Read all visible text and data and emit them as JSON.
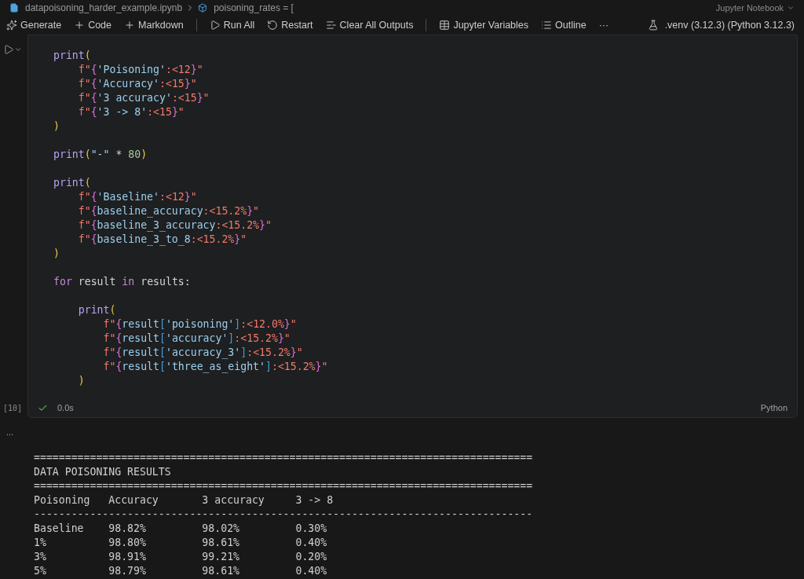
{
  "breadcrumb": {
    "file": "datapoisoning_harder_example.ipynb",
    "symbol": "poisoning_rates = ["
  },
  "editor_mode": "Jupyter Notebook",
  "toolbar": [
    {
      "kind": "generate",
      "label": "Generate"
    },
    {
      "kind": "add",
      "label": "Code"
    },
    {
      "kind": "add",
      "label": "Markdown"
    },
    {
      "kind": "separator"
    },
    {
      "kind": "run",
      "label": "Run All"
    },
    {
      "kind": "restart",
      "label": "Restart"
    },
    {
      "kind": "clear",
      "label": "Clear All Outputs"
    },
    {
      "kind": "separator"
    },
    {
      "kind": "variables",
      "label": "Jupyter Variables"
    },
    {
      "kind": "outline",
      "label": "Outline"
    },
    {
      "kind": "more",
      "label": "···"
    }
  ],
  "kernel": ".venv (3.12.3) (Python 3.12.3)",
  "cell": {
    "execution_count": "[10]",
    "succeeded": true,
    "duration": "0.0s",
    "language": "Python",
    "lines": [
      {
        "kind": "code",
        "tokens": [
          {
            "kind": "fn",
            "text": "print"
          },
          {
            "kind": "paren",
            "text": "("
          }
        ]
      },
      {
        "kind": "code",
        "tokens": [
          {
            "kind": "fstr",
            "text": "    f\""
          },
          {
            "kind": "brace",
            "text": "{"
          },
          {
            "kind": "expr",
            "text": "'Poisoning'"
          },
          {
            "kind": "spec",
            "text": ":<12"
          },
          {
            "kind": "brace",
            "text": "}"
          },
          {
            "kind": "fstr",
            "text": "\""
          }
        ]
      },
      {
        "kind": "code",
        "tokens": [
          {
            "kind": "fstr",
            "text": "    f\""
          },
          {
            "kind": "brace",
            "text": "{"
          },
          {
            "kind": "expr",
            "text": "'Accuracy'"
          },
          {
            "kind": "spec",
            "text": ":<15"
          },
          {
            "kind": "brace",
            "text": "}"
          },
          {
            "kind": "fstr",
            "text": "\""
          }
        ]
      },
      {
        "kind": "code",
        "tokens": [
          {
            "kind": "fstr",
            "text": "    f\""
          },
          {
            "kind": "brace",
            "text": "{"
          },
          {
            "kind": "expr",
            "text": "'3 accuracy'"
          },
          {
            "kind": "spec",
            "text": ":<15"
          },
          {
            "kind": "brace",
            "text": "}"
          },
          {
            "kind": "fstr",
            "text": "\""
          }
        ]
      },
      {
        "kind": "code",
        "tokens": [
          {
            "kind": "fstr",
            "text": "    f\""
          },
          {
            "kind": "brace",
            "text": "{"
          },
          {
            "kind": "expr",
            "text": "'3 -> 8'"
          },
          {
            "kind": "spec",
            "text": ":<15"
          },
          {
            "kind": "brace",
            "text": "}"
          },
          {
            "kind": "fstr",
            "text": "\""
          }
        ]
      },
      {
        "kind": "code",
        "tokens": [
          {
            "kind": "paren",
            "text": ")"
          }
        ]
      },
      {
        "kind": "blank"
      },
      {
        "kind": "code",
        "tokens": [
          {
            "kind": "fn",
            "text": "print"
          },
          {
            "kind": "paren",
            "text": "("
          },
          {
            "kind": "str",
            "text": "\"-\""
          },
          {
            "kind": "op",
            "text": " * "
          },
          {
            "kind": "num",
            "text": "80"
          },
          {
            "kind": "paren",
            "text": ")"
          }
        ]
      },
      {
        "kind": "blank"
      },
      {
        "kind": "code",
        "tokens": [
          {
            "kind": "fn",
            "text": "print"
          },
          {
            "kind": "paren",
            "text": "("
          }
        ]
      },
      {
        "kind": "code",
        "tokens": [
          {
            "kind": "fstr",
            "text": "    f\""
          },
          {
            "kind": "brace",
            "text": "{"
          },
          {
            "kind": "expr",
            "text": "'Baseline'"
          },
          {
            "kind": "spec",
            "text": ":<12"
          },
          {
            "kind": "brace",
            "text": "}"
          },
          {
            "kind": "fstr",
            "text": "\""
          }
        ]
      },
      {
        "kind": "code",
        "tokens": [
          {
            "kind": "fstr",
            "text": "    f\""
          },
          {
            "kind": "brace",
            "text": "{"
          },
          {
            "kind": "expr",
            "text": "baseline_accuracy"
          },
          {
            "kind": "spec",
            "text": ":<15.2%"
          },
          {
            "kind": "brace",
            "text": "}"
          },
          {
            "kind": "fstr",
            "text": "\""
          }
        ]
      },
      {
        "kind": "code",
        "tokens": [
          {
            "kind": "fstr",
            "text": "    f\""
          },
          {
            "kind": "brace",
            "text": "{"
          },
          {
            "kind": "expr",
            "text": "baseline_3_accuracy"
          },
          {
            "kind": "spec",
            "text": ":<15.2%"
          },
          {
            "kind": "brace",
            "text": "}"
          },
          {
            "kind": "fstr",
            "text": "\""
          }
        ]
      },
      {
        "kind": "code",
        "tokens": [
          {
            "kind": "fstr",
            "text": "    f\""
          },
          {
            "kind": "brace",
            "text": "{"
          },
          {
            "kind": "expr",
            "text": "baseline_3_to_8"
          },
          {
            "kind": "spec",
            "text": ":<15.2%"
          },
          {
            "kind": "brace",
            "text": "}"
          },
          {
            "kind": "fstr",
            "text": "\""
          }
        ]
      },
      {
        "kind": "code",
        "tokens": [
          {
            "kind": "paren",
            "text": ")"
          }
        ]
      },
      {
        "kind": "blank"
      },
      {
        "kind": "code",
        "tokens": [
          {
            "kind": "kw",
            "text": "for"
          },
          {
            "kind": "op",
            "text": " result "
          },
          {
            "kind": "kw",
            "text": "in"
          },
          {
            "kind": "op",
            "text": " results:"
          }
        ]
      },
      {
        "kind": "blank"
      },
      {
        "kind": "code",
        "tokens": [
          {
            "kind": "fn",
            "text": "    print"
          },
          {
            "kind": "paren",
            "text": "("
          }
        ]
      },
      {
        "kind": "code",
        "tokens": [
          {
            "kind": "fstr",
            "text": "        f\""
          },
          {
            "kind": "brace",
            "text": "{"
          },
          {
            "kind": "expr",
            "text": "result"
          },
          {
            "kind": "bracket",
            "text": "["
          },
          {
            "kind": "expr",
            "text": "'poisoning'"
          },
          {
            "kind": "bracket",
            "text": "]"
          },
          {
            "kind": "spec",
            "text": ":<12.0%"
          },
          {
            "kind": "brace",
            "text": "}"
          },
          {
            "kind": "fstr",
            "text": "\""
          }
        ]
      },
      {
        "kind": "code",
        "tokens": [
          {
            "kind": "fstr",
            "text": "        f\""
          },
          {
            "kind": "brace",
            "text": "{"
          },
          {
            "kind": "expr",
            "text": "result"
          },
          {
            "kind": "bracket",
            "text": "["
          },
          {
            "kind": "expr",
            "text": "'accuracy'"
          },
          {
            "kind": "bracket",
            "text": "]"
          },
          {
            "kind": "spec",
            "text": ":<15.2%"
          },
          {
            "kind": "brace",
            "text": "}"
          },
          {
            "kind": "fstr",
            "text": "\""
          }
        ]
      },
      {
        "kind": "code",
        "tokens": [
          {
            "kind": "fstr",
            "text": "        f\""
          },
          {
            "kind": "brace",
            "text": "{"
          },
          {
            "kind": "expr",
            "text": "result"
          },
          {
            "kind": "bracket",
            "text": "["
          },
          {
            "kind": "expr",
            "text": "'accuracy_3'"
          },
          {
            "kind": "bracket",
            "text": "]"
          },
          {
            "kind": "spec",
            "text": ":<15.2%"
          },
          {
            "kind": "brace",
            "text": "}"
          },
          {
            "kind": "fstr",
            "text": "\""
          }
        ]
      },
      {
        "kind": "code",
        "tokens": [
          {
            "kind": "fstr",
            "text": "        f\""
          },
          {
            "kind": "brace",
            "text": "{"
          },
          {
            "kind": "expr",
            "text": "result"
          },
          {
            "kind": "bracket",
            "text": "["
          },
          {
            "kind": "expr",
            "text": "'three_as_eight'"
          },
          {
            "kind": "bracket",
            "text": "]"
          },
          {
            "kind": "spec",
            "text": ":<15.2%"
          },
          {
            "kind": "brace",
            "text": "}"
          },
          {
            "kind": "fstr",
            "text": "\""
          }
        ]
      },
      {
        "kind": "code",
        "tokens": [
          {
            "kind": "paren",
            "text": "    )"
          }
        ]
      }
    ]
  },
  "output": {
    "menu": "...",
    "lines": [
      "================================================================================",
      "DATA POISONING RESULTS",
      "================================================================================",
      "Poisoning   Accuracy       3 accuracy     3 -> 8",
      "--------------------------------------------------------------------------------",
      "Baseline    98.82%         98.02%         0.30%",
      "1%          98.80%         98.61%         0.40%",
      "3%          98.91%         99.21%         0.20%",
      "5%          98.79%         98.61%         0.40%"
    ]
  }
}
